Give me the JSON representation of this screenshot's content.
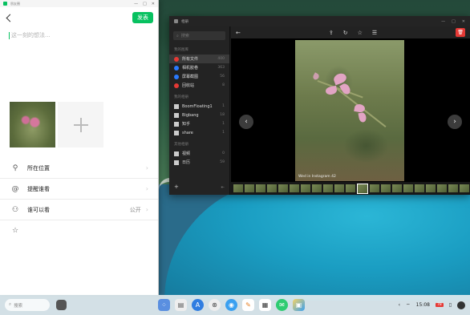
{
  "post_window": {
    "title": "朋友圈",
    "send_label": "发表",
    "text_placeholder": "这一刻的想法...",
    "options": [
      {
        "name": "location",
        "icon": "location-pin-icon",
        "label": "所在位置",
        "value": ""
      },
      {
        "name": "mention",
        "icon": "at-icon",
        "label": "提醒谁看",
        "value": ""
      },
      {
        "name": "visibility",
        "icon": "person-icon",
        "label": "谁可以看",
        "value": "公开"
      },
      {
        "name": "favorite",
        "icon": "star-icon",
        "label": "",
        "value": ""
      }
    ]
  },
  "viewer": {
    "title": "相册",
    "search_placeholder": "搜索",
    "section_library": "我的图库",
    "library_items": [
      {
        "label": "所有文件",
        "count": "400",
        "color": "#e53935"
      },
      {
        "label": "相机胶卷",
        "count": "363",
        "color": "#2979ff"
      },
      {
        "label": "屏幕截图",
        "count": "56",
        "color": "#2979ff"
      },
      {
        "label": "回收站",
        "count": "8",
        "color": "#e53935"
      }
    ],
    "section_albums": "我的相册",
    "album_items": [
      {
        "label": "BoomFloating1",
        "count": "1"
      },
      {
        "label": "Bigbang",
        "count": "18"
      },
      {
        "label": "知乎",
        "count": "1"
      },
      {
        "label": "share",
        "count": "1"
      }
    ],
    "section_other": "其他相册",
    "other_items": [
      {
        "label": "视频",
        "count": "0"
      },
      {
        "label": "日历",
        "count": "59"
      }
    ],
    "image_caption": "Wed in Instagram 42",
    "filmstrip_count": 24,
    "filmstrip_selected": 11
  },
  "taskbar": {
    "search_placeholder": "搜索",
    "time": "15:08",
    "battery": "78",
    "dock_icons": [
      "launcher-icon",
      "file-manager-icon",
      "app-store-icon",
      "mercedes-app-icon",
      "browser-icon",
      "notes-icon",
      "calendar-icon",
      "wechat-icon",
      "gallery-icon"
    ]
  }
}
